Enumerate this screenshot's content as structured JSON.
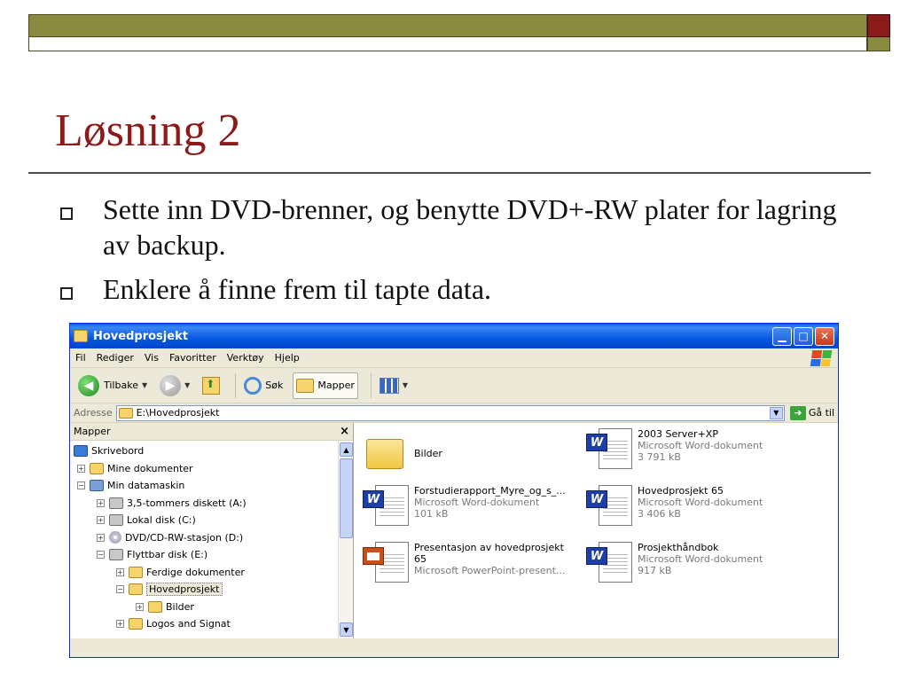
{
  "slide": {
    "title": "Løsning 2",
    "bullets": [
      "Sette inn DVD-brenner, og benytte DVD+-RW plater for lagring av backup.",
      "Enklere å finne frem til tapte data."
    ],
    "colors": {
      "title": "#8b1a1a",
      "band": "#8a8a40",
      "accent": "#8b1a1a"
    }
  },
  "window": {
    "title": "Hovedprosjekt",
    "menu": [
      "Fil",
      "Rediger",
      "Vis",
      "Favoritter",
      "Verktøy",
      "Hjelp"
    ],
    "toolbar": {
      "back": "Tilbake",
      "search": "Søk",
      "folders": "Mapper"
    },
    "address": {
      "label": "Adresse",
      "value": "E:\\Hovedprosjekt",
      "go": "Gå til"
    },
    "tree": {
      "header": "Mapper",
      "close": "×",
      "items": [
        {
          "label": "Skrivebord",
          "icon": "desktop-icon"
        },
        {
          "label": "Mine dokumenter",
          "icon": "folder-icon"
        },
        {
          "label": "Min datamaskin",
          "icon": "computer-icon"
        },
        {
          "label": "3,5-tommers diskett (A:)",
          "icon": "floppy-icon"
        },
        {
          "label": "Lokal disk (C:)",
          "icon": "drive-icon"
        },
        {
          "label": "DVD/CD-RW-stasjon (D:)",
          "icon": "cd-icon"
        },
        {
          "label": "Flyttbar disk (E:)",
          "icon": "drive-icon"
        },
        {
          "label": "Ferdige dokumenter",
          "icon": "folder-icon"
        },
        {
          "label": "Hovedprosjekt",
          "icon": "folder-icon"
        },
        {
          "label": "Bilder",
          "icon": "folder-icon"
        },
        {
          "label": "Logos and Signat",
          "icon": "folder-icon"
        }
      ]
    },
    "files": [
      {
        "name": "Bilder",
        "type": "",
        "size": "",
        "icon": "folder-icon"
      },
      {
        "name": "2003 Server+XP",
        "type": "Microsoft Word-dokument",
        "size": "3 791 kB",
        "icon": "word-icon"
      },
      {
        "name": "Forstudierapport_Myre_og_s_...",
        "type": "Microsoft Word-dokument",
        "size": "101 kB",
        "icon": "word-icon"
      },
      {
        "name": "Hovedprosjekt 65",
        "type": "Microsoft Word-dokument",
        "size": "3 406 kB",
        "icon": "word-icon"
      },
      {
        "name": "Presentasjon av hovedprosjekt",
        "name2": "65",
        "type": "Microsoft PowerPoint-present...",
        "size": "",
        "icon": "powerpoint-icon"
      },
      {
        "name": "Prosjekthåndbok",
        "type": "Microsoft Word-dokument",
        "size": "917 kB",
        "icon": "word-icon"
      }
    ],
    "colors": {
      "titlebar": "#0558e0",
      "chrome": "#ece9d8",
      "border": "#0831d9"
    }
  }
}
